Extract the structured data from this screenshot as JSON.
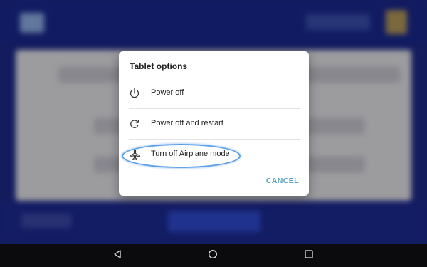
{
  "dialog": {
    "title": "Tablet options",
    "options": [
      {
        "label": "Power off",
        "icon": "power-icon"
      },
      {
        "label": "Power off and restart",
        "icon": "restart-icon"
      },
      {
        "label": "Turn off Airplane mode",
        "icon": "airplane-icon"
      }
    ],
    "cancel_label": "CANCEL"
  },
  "navbar": {
    "back_icon": "back-triangle-icon",
    "home_icon": "home-circle-icon",
    "recent_icon": "recent-apps-square-icon"
  },
  "colors": {
    "background_blue": "#1e2a8a",
    "cancel_accent": "#5aa0c4",
    "highlight_annotation": "#5b9ee8"
  }
}
